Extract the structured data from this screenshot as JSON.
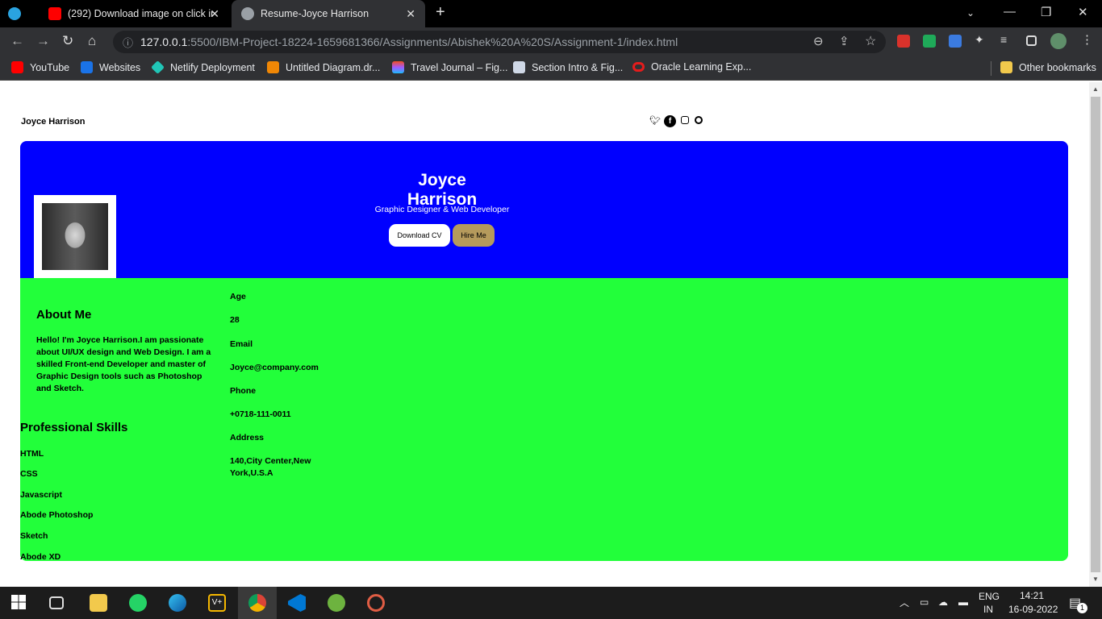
{
  "browser": {
    "tabs": [
      {
        "label": "",
        "icon": "telegram-icon"
      },
      {
        "label": "(292) Download image on click in",
        "icon": "youtube-icon"
      },
      {
        "label": "Resume-Joyce Harrison",
        "icon": "globe-icon"
      }
    ],
    "new_tab": "+",
    "url_host": "127.0.0.1",
    "url_rest": ":5500/IBM-Project-18224-1659681366/Assignments/Abishek%20A%20S/Assignment-1/index.html",
    "bookmarks": [
      "YouTube",
      "Websites",
      "Netlify Deployment",
      "Untitled Diagram.dr...",
      "Travel Journal – Fig...",
      "Section Intro & Fig...",
      "Oracle Learning Exp..."
    ],
    "other_bookmarks": "Other bookmarks"
  },
  "page": {
    "site_name": "Joyce Harrison",
    "hero": {
      "name": "Joyce Harrison",
      "title": "Graphic Designer & Web Developer",
      "download_cv": "Download CV",
      "hire_me": "Hire Me"
    },
    "about": {
      "heading": "About Me",
      "text": "Hello! I'm Joyce Harrison.I am passionate about UI/UX design and Web Design. I am a skilled Front-end Developer and master of Graphic Design tools such as Photoshop and Sketch."
    },
    "skills": {
      "heading": "Professional Skills",
      "items": [
        "HTML",
        "CSS",
        "Javascript",
        "Abode Photoshop",
        "Sketch",
        "Abode XD"
      ]
    },
    "info": {
      "age_label": "Age",
      "age": "28",
      "email_label": "Email",
      "email": "Joyce@company.com",
      "phone_label": "Phone",
      "phone": "+0718-111-0011",
      "address_label": "Address",
      "address": "140,City Center,New York,U.S.A"
    }
  },
  "taskbar": {
    "lang1": "ENG",
    "lang2": "IN",
    "time": "14:21",
    "date": "16-09-2022",
    "notifications": "1"
  },
  "colors": {
    "hero_bg": "#0000ff",
    "main_bg": "#22ff3a",
    "hire_btn": "#b59a5c"
  }
}
